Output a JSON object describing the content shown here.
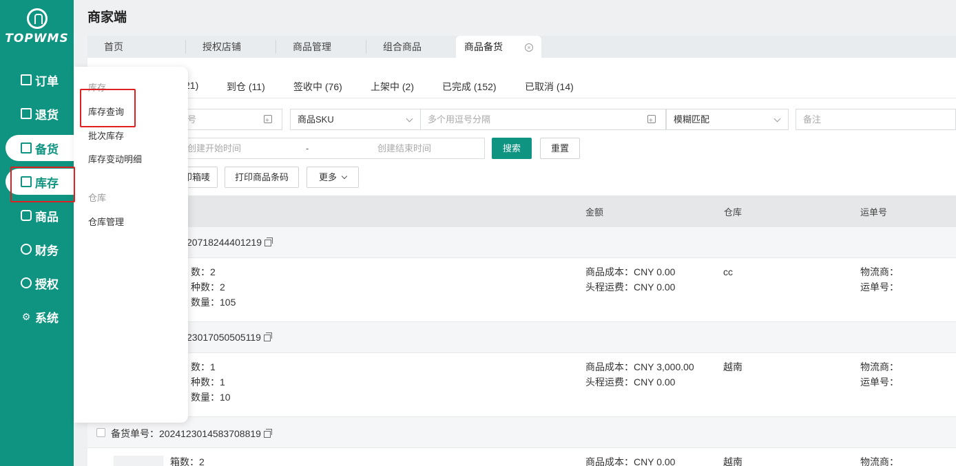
{
  "app": {
    "title": "商家端",
    "logo_text": "TOPWMS"
  },
  "sidebar": {
    "items": [
      {
        "label": "订单",
        "icon": "list-icon"
      },
      {
        "label": "退货",
        "icon": "return-icon"
      },
      {
        "label": "备货",
        "icon": "mail-icon"
      },
      {
        "label": "库存",
        "icon": "inventory-icon"
      },
      {
        "label": "商品",
        "icon": "bag-icon"
      },
      {
        "label": "财务",
        "icon": "finance-icon"
      },
      {
        "label": "授权",
        "icon": "badge-icon"
      },
      {
        "label": "系统",
        "icon": "gear-icon"
      }
    ]
  },
  "flyout": {
    "group1": "库存",
    "items1": [
      "库存查询",
      "批次库存",
      "库存变动明细"
    ],
    "group2": "仓库",
    "items2": [
      "仓库管理"
    ]
  },
  "tabs": [
    "首页",
    "授权店铺",
    "商品管理",
    "组合商品",
    "商品备货"
  ],
  "status_tabs": [
    {
      "label": "21)"
    },
    {
      "label": "到仓 (11)"
    },
    {
      "label": "签收中 (76)"
    },
    {
      "label": "上架中 (2)"
    },
    {
      "label": "已完成 (152)"
    },
    {
      "label": "已取消 (14)"
    }
  ],
  "filters": {
    "field1_fragment": "号",
    "sku_select": "商品SKU",
    "sku_placeholder": "多个用逗号分隔",
    "match_select": "模糊匹配",
    "remark_placeholder": "备注",
    "start_time": "创建开始时间",
    "dash": "-",
    "end_time": "创建结束时间",
    "search": "搜索",
    "reset": "重置"
  },
  "actions": {
    "print_box": "印箱唛",
    "print_barcode": "打印商品条码",
    "more": "更多"
  },
  "table": {
    "headers": {
      "amount": "金额",
      "warehouse": "仓库",
      "tracking": "运单号"
    },
    "groups": [
      {
        "order_no": "20718244401219",
        "l1": "数：2",
        "l2": "种数：2",
        "l3": "数量：105",
        "cost": "商品成本：CNY 0.00",
        "freight": "头程运费：CNY 0.00",
        "warehouse": "cc",
        "carrier": "物流商：",
        "waybill": "运单号："
      },
      {
        "order_no": "23017050505119",
        "l1": "数：1",
        "l2": "种数：1",
        "l3": "数量：10",
        "cost": "商品成本：CNY 3,000.00",
        "freight": "头程运费：CNY 0.00",
        "warehouse": "越南",
        "carrier": "物流商：",
        "waybill": "运单号："
      },
      {
        "order_label": "备货单号：",
        "order_no": "2024123014583708819",
        "l1": "箱数：2",
        "cost": "商品成本：CNY 0.00",
        "warehouse": "越南",
        "carrier": "物流商："
      }
    ]
  },
  "colors": {
    "brand": "#0e9480",
    "highlight": "#e02020"
  }
}
